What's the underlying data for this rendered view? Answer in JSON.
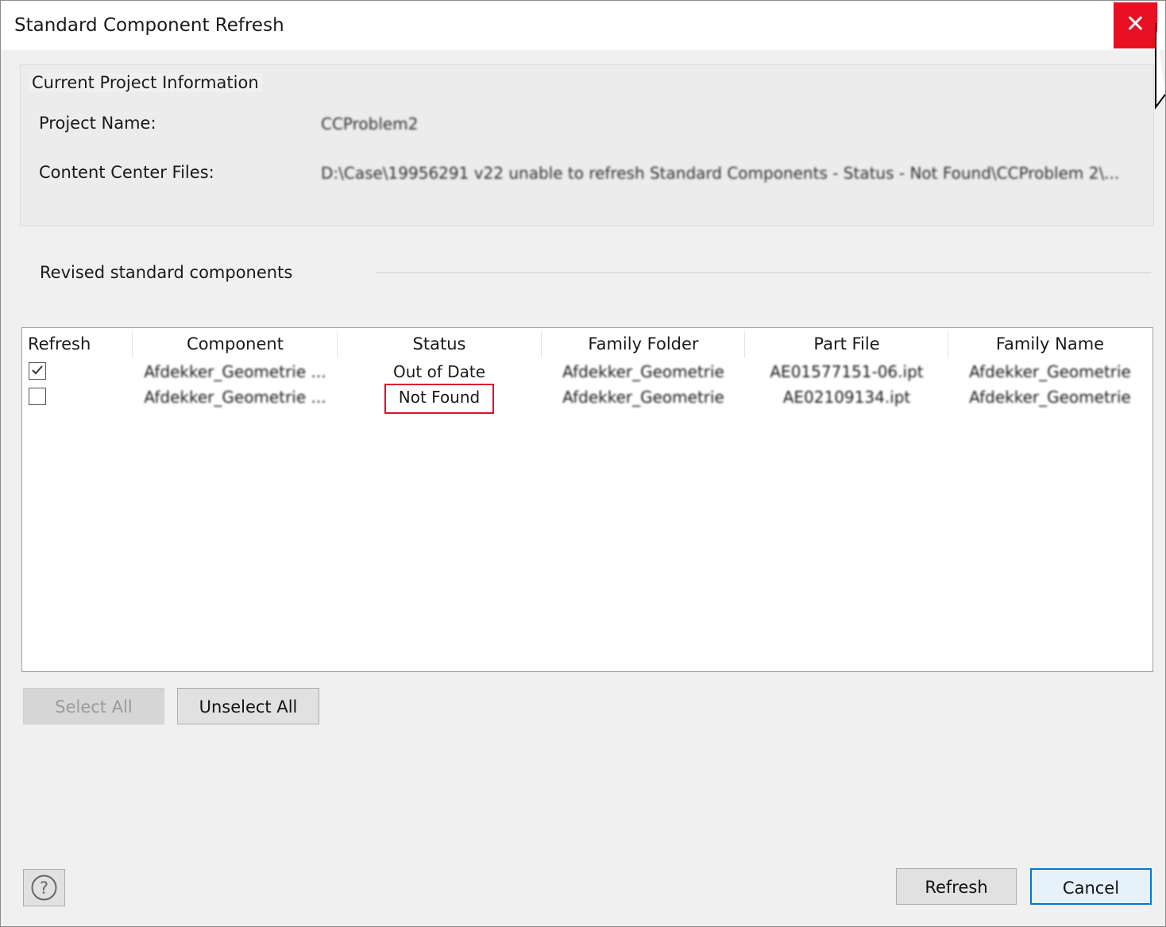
{
  "window": {
    "title": "Standard Component Refresh",
    "close_glyph": "✕"
  },
  "project_info": {
    "group_title": "Current Project Information",
    "project_name_label": "Project Name:",
    "project_name_value": "CCProblem2",
    "cc_files_label": "Content Center Files:",
    "cc_files_value": "D:\\Case\\19956291 v22 unable to refresh Standard Components - Status - Not Found\\CCProblem 2\\..."
  },
  "revised": {
    "section_title": "Revised standard components"
  },
  "table": {
    "columns": [
      "Refresh",
      "Component",
      "Status",
      "Family Folder",
      "Part File",
      "Family Name"
    ],
    "rows": [
      {
        "refresh": true,
        "component": "Afdekker_Geometrie ...",
        "status": "Out of Date",
        "family_folder": "Afdekker_Geometrie",
        "part_file": "AE01577151-06.ipt",
        "family_name": "Afdekker_Geometrie"
      },
      {
        "refresh": false,
        "component": "Afdekker_Geometrie ...",
        "status": "Not Found",
        "family_folder": "Afdekker_Geometrie",
        "part_file": "AE02109134.ipt",
        "family_name": "Afdekker_Geometrie"
      }
    ],
    "highlight_color": "#e0102a"
  },
  "buttons": {
    "select_all": "Select All",
    "unselect_all": "Unselect All",
    "refresh": "Refresh",
    "cancel": "Cancel"
  },
  "icons": {
    "help": "help-icon",
    "close": "close-icon"
  }
}
